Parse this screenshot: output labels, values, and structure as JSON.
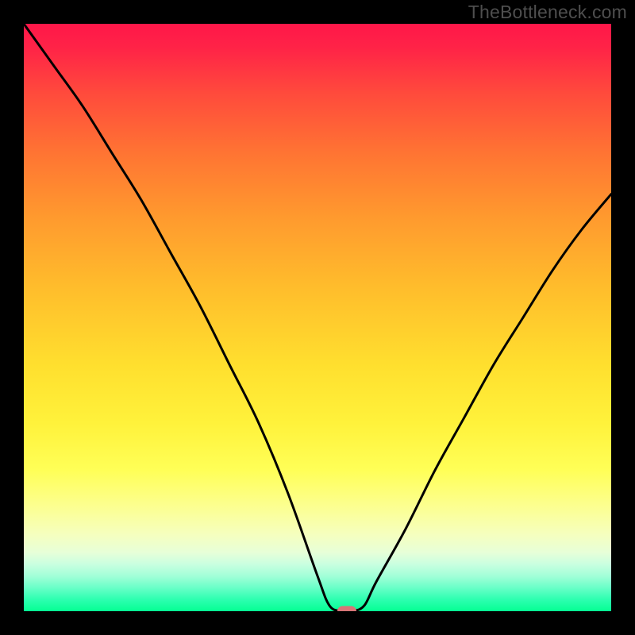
{
  "watermark": "TheBottleneck.com",
  "chart_data": {
    "type": "line",
    "title": "",
    "xlabel": "",
    "ylabel": "",
    "xlim": [
      0,
      100
    ],
    "ylim": [
      0,
      100
    ],
    "grid": false,
    "legend": false,
    "series": [
      {
        "name": "bottleneck-curve",
        "x": [
          0,
          5,
          10,
          15,
          20,
          25,
          30,
          35,
          40,
          45,
          50,
          52,
          54,
          56,
          58,
          60,
          65,
          70,
          75,
          80,
          85,
          90,
          95,
          100
        ],
        "y": [
          100,
          93,
          86,
          78,
          70,
          61,
          52,
          42,
          32,
          20,
          6,
          1,
          0,
          0,
          1,
          5,
          14,
          24,
          33,
          42,
          50,
          58,
          65,
          71
        ]
      }
    ],
    "marker": {
      "x": 55,
      "y": 0,
      "color": "#d87577"
    },
    "background_gradient": {
      "top": "#ff1749",
      "mid": "#ffff57",
      "bottom": "#05ff93"
    }
  }
}
